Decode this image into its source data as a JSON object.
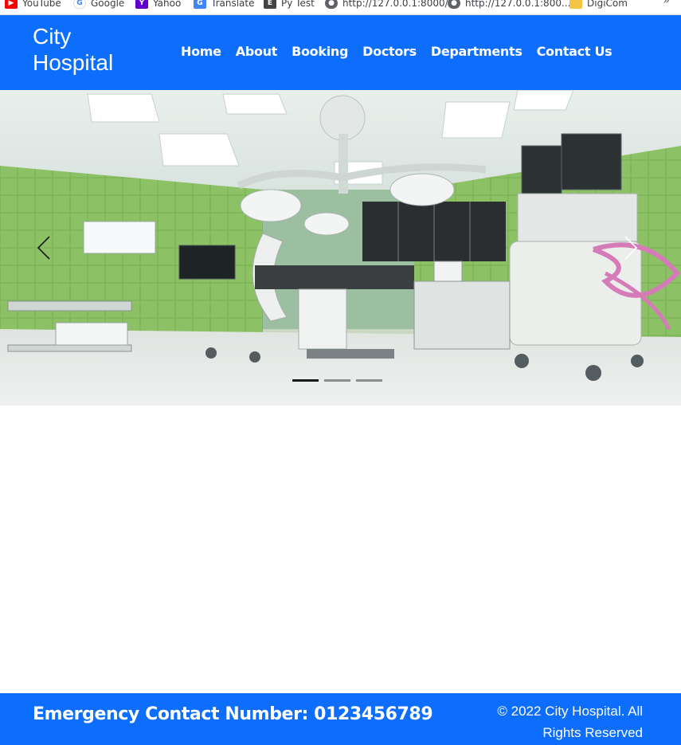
{
  "bookmarks": [
    {
      "label": "YouTube",
      "icon": "youtube-icon",
      "color": "#ff0000"
    },
    {
      "label": "Google",
      "icon": "google-icon",
      "color": "#4285f4"
    },
    {
      "label": "Yahoo",
      "icon": "yahoo-icon",
      "color": "#6001d2"
    },
    {
      "label": "Translate",
      "icon": "translate-icon",
      "color": "#4285f4"
    },
    {
      "label": "Py Test",
      "icon": "pytest-icon",
      "color": "#444444"
    },
    {
      "label": "http://127.0.0.1:8000/",
      "icon": "globe-icon",
      "color": "#5f6368"
    },
    {
      "label": "http://127.0.0.1:800...",
      "icon": "globe-icon",
      "color": "#5f6368"
    },
    {
      "label": "DigiCom",
      "icon": "folder-icon",
      "color": "#f4c542"
    }
  ],
  "bookmarks_more": "»",
  "brand": "City Hospital",
  "nav": {
    "home": "Home",
    "about": "About",
    "booking": "Booking",
    "doctors": "Doctors",
    "departments": "Departments",
    "contact": "Contact Us"
  },
  "carousel": {
    "slides": 3,
    "active_slide": 1,
    "prev_icon": "chevron-left-icon",
    "next_icon": "chevron-right-icon"
  },
  "footer": {
    "emergency": "Emergency Contact Number: 0123456789",
    "copyright": "© 2022 City Hospital. All Rights Reserved"
  },
  "colors": {
    "brand_blue": "#0d6efd",
    "white": "#ffffff"
  }
}
